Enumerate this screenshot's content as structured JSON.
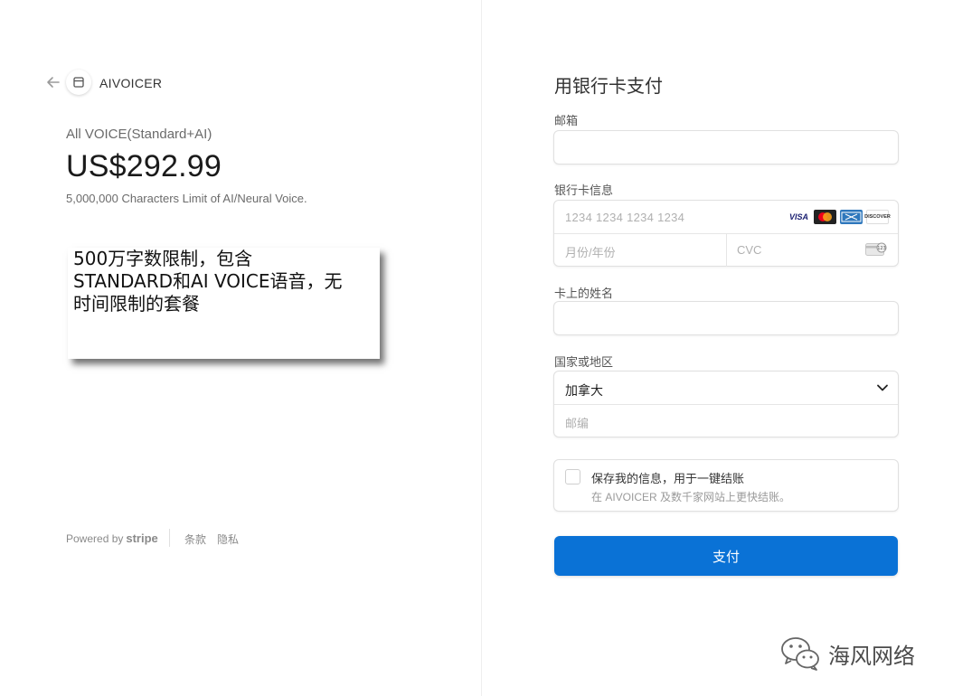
{
  "merchant": {
    "name": "AIVOICER"
  },
  "product": {
    "name": "All VOICE(Standard+AI)",
    "price": "US$292.99",
    "description": "5,000,000 Characters Limit of AI/Neural Voice."
  },
  "note": {
    "text": "500万字数限制，包含\nSTANDARD和AI VOICE语音，无\n时间限制的套餐"
  },
  "footer": {
    "powered_by": "Powered by",
    "stripe": "stripe",
    "terms": "条款",
    "privacy": "隐私"
  },
  "form": {
    "title": "用银行卡支付",
    "email_label": "邮箱",
    "card_label": "银行卡信息",
    "card_number_placeholder": "1234 1234 1234 1234",
    "expiry_placeholder": "月份/年份",
    "cvc_placeholder": "CVC",
    "card_brands": [
      "VISA",
      "mastercard",
      "AMEX",
      "DISCOVER"
    ],
    "name_label": "卡上的姓名",
    "country_label": "国家或地区",
    "country_value": "加拿大",
    "postal_placeholder": "邮编",
    "save_title": "保存我的信息，用于一键结账",
    "save_subtitle": "在 AIVOICER 及数千家网站上更快结账。",
    "pay_button": "支付"
  },
  "watermark": {
    "text": "海风网络"
  },
  "colors": {
    "accent": "#0a72d6",
    "border": "#e0e0e0",
    "muted_text": "#8a8a8a"
  }
}
